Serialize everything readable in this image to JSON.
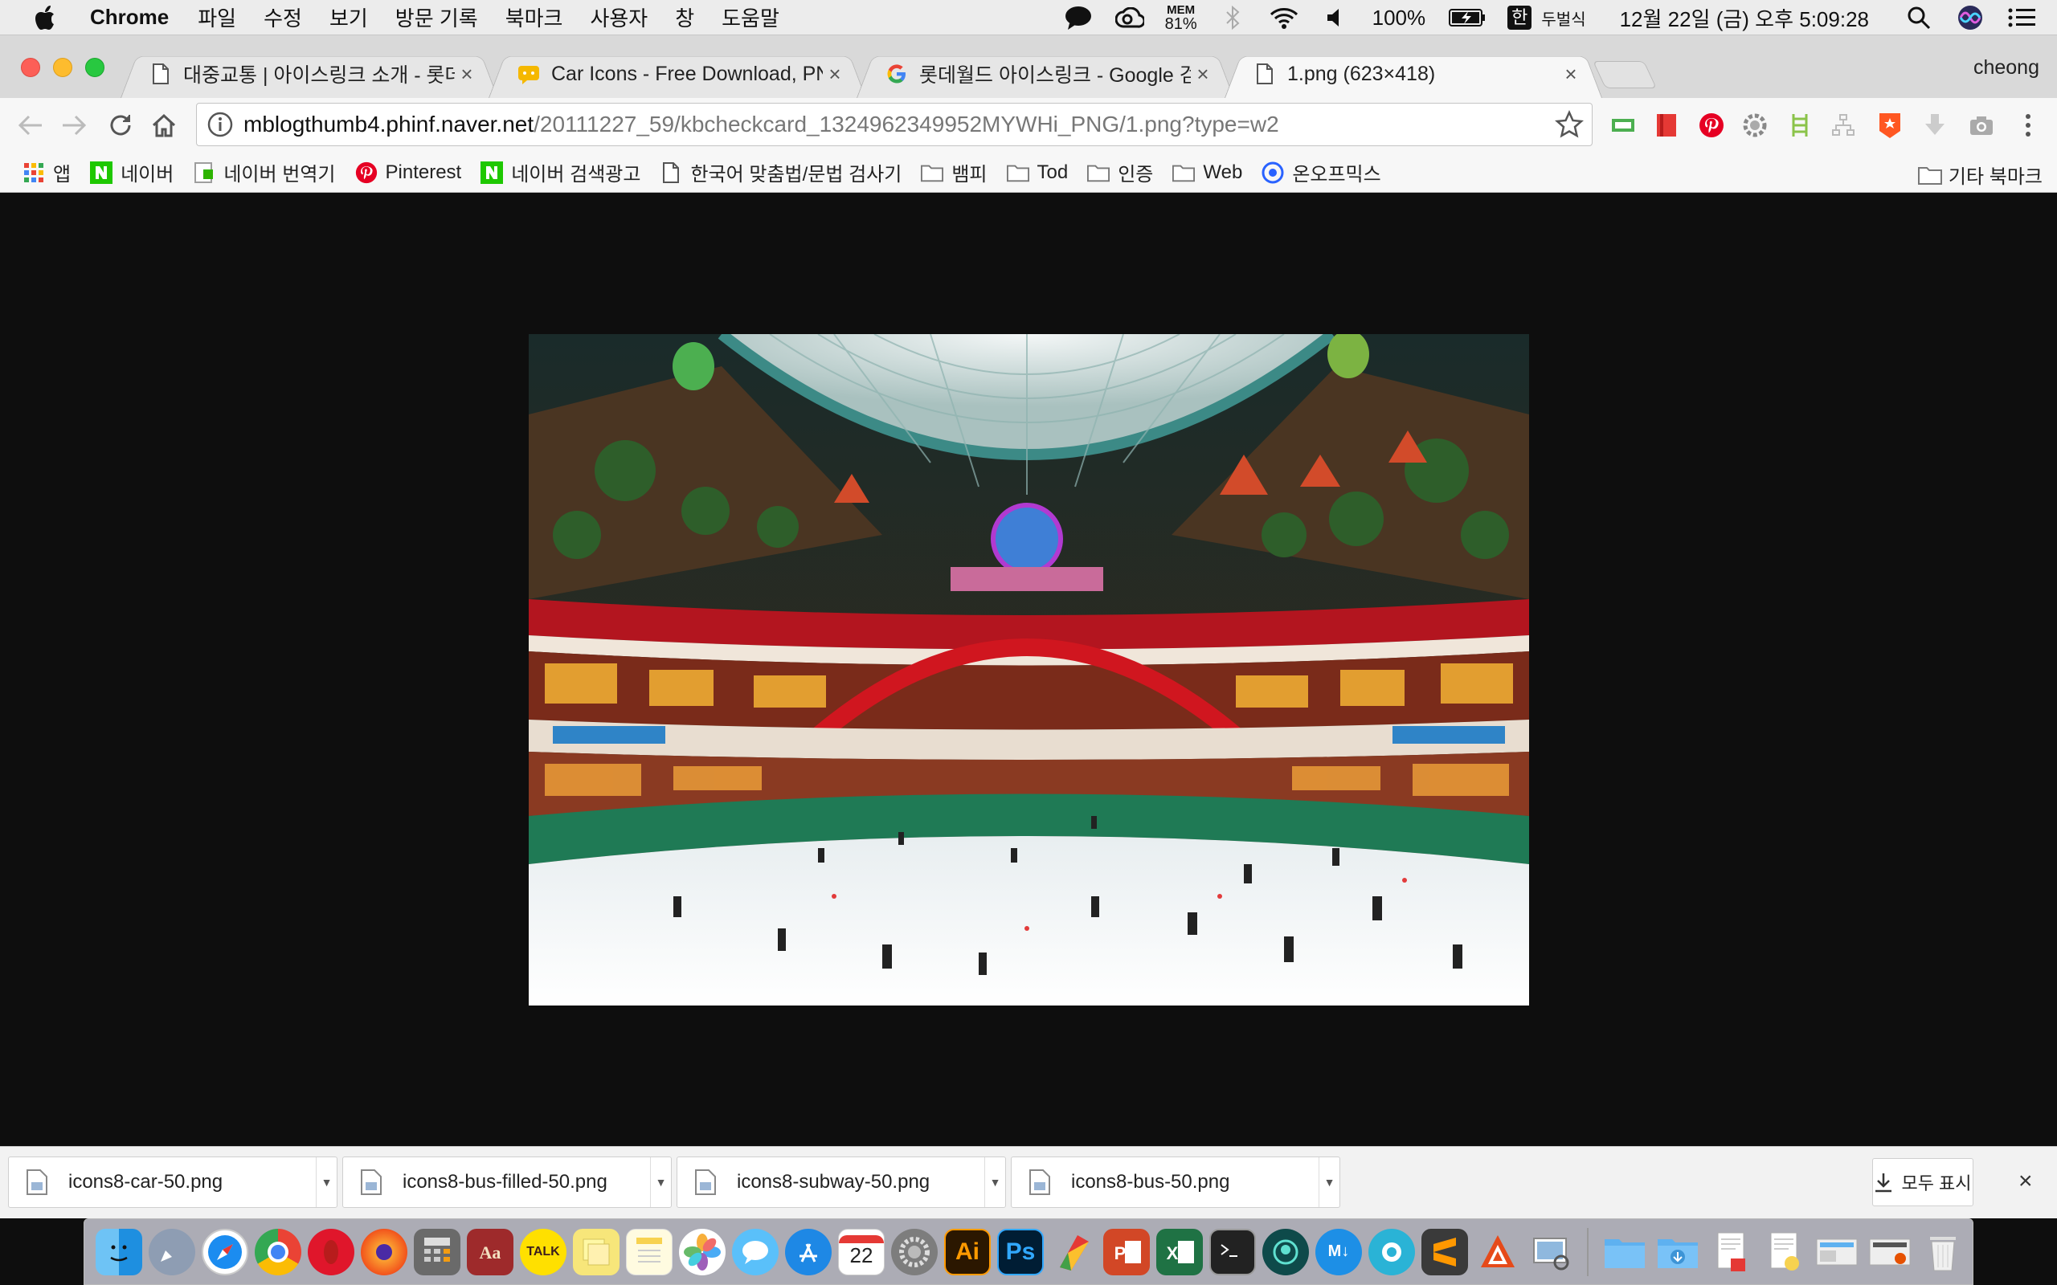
{
  "menubar": {
    "app_name": "Chrome",
    "menus": [
      "파일",
      "수정",
      "보기",
      "방문 기록",
      "북마크",
      "사용자",
      "창",
      "도움말"
    ],
    "mem_label": "MEM",
    "mem_value": "81%",
    "battery": "100%",
    "ime": "한",
    "input_source": "두벌식",
    "clock": "12월 22일 (금) 오후  5:09:28"
  },
  "tabs": [
    {
      "title": "대중교통 | 아이스링크 소개 - 롯데월",
      "icon": "page-icon"
    },
    {
      "title": "Car Icons - Free Download, PN",
      "icon": "icons8-icon"
    },
    {
      "title": "롯데월드 아이스링크 - Google 검색",
      "icon": "google-icon"
    },
    {
      "title": "1.png (623×418)",
      "icon": "page-icon"
    }
  ],
  "close_glyph": "×",
  "profile": "cheong",
  "address": {
    "host": "mblogthumb4.phinf.naver.net",
    "path": "/20111227_59/kbcheckcard_1324962349952MYWHi_PNG/1.png?type=w2"
  },
  "bookmarks": [
    {
      "label": "앱",
      "icon": "apps-grid-icon"
    },
    {
      "label": "네이버",
      "icon": "naver-icon"
    },
    {
      "label": "네이버 번역기",
      "icon": "papago-icon"
    },
    {
      "label": "Pinterest",
      "icon": "pinterest-icon"
    },
    {
      "label": "네이버 검색광고",
      "icon": "naver-icon"
    },
    {
      "label": "한국어 맞춤법/문법 검사기",
      "icon": "page-icon"
    },
    {
      "label": "뱀피",
      "icon": "folder-icon"
    },
    {
      "label": "Tod",
      "icon": "folder-icon"
    },
    {
      "label": "인증",
      "icon": "folder-icon"
    },
    {
      "label": "Web",
      "icon": "folder-icon"
    },
    {
      "label": "온오프믹스",
      "icon": "onoffmix-icon"
    }
  ],
  "other_bookmarks": "기타 북마크",
  "downloads": [
    {
      "name": "icons8-car-50.png"
    },
    {
      "name": "icons8-bus-filled-50.png"
    },
    {
      "name": "icons8-subway-50.png"
    },
    {
      "name": "icons8-bus-50.png"
    }
  ],
  "show_all": "모두 표시",
  "dock": {
    "ai_label": "Ai",
    "ps_label": "Ps",
    "talk_label": "TALK",
    "calendar_day": "22",
    "md_label": "M↓"
  }
}
